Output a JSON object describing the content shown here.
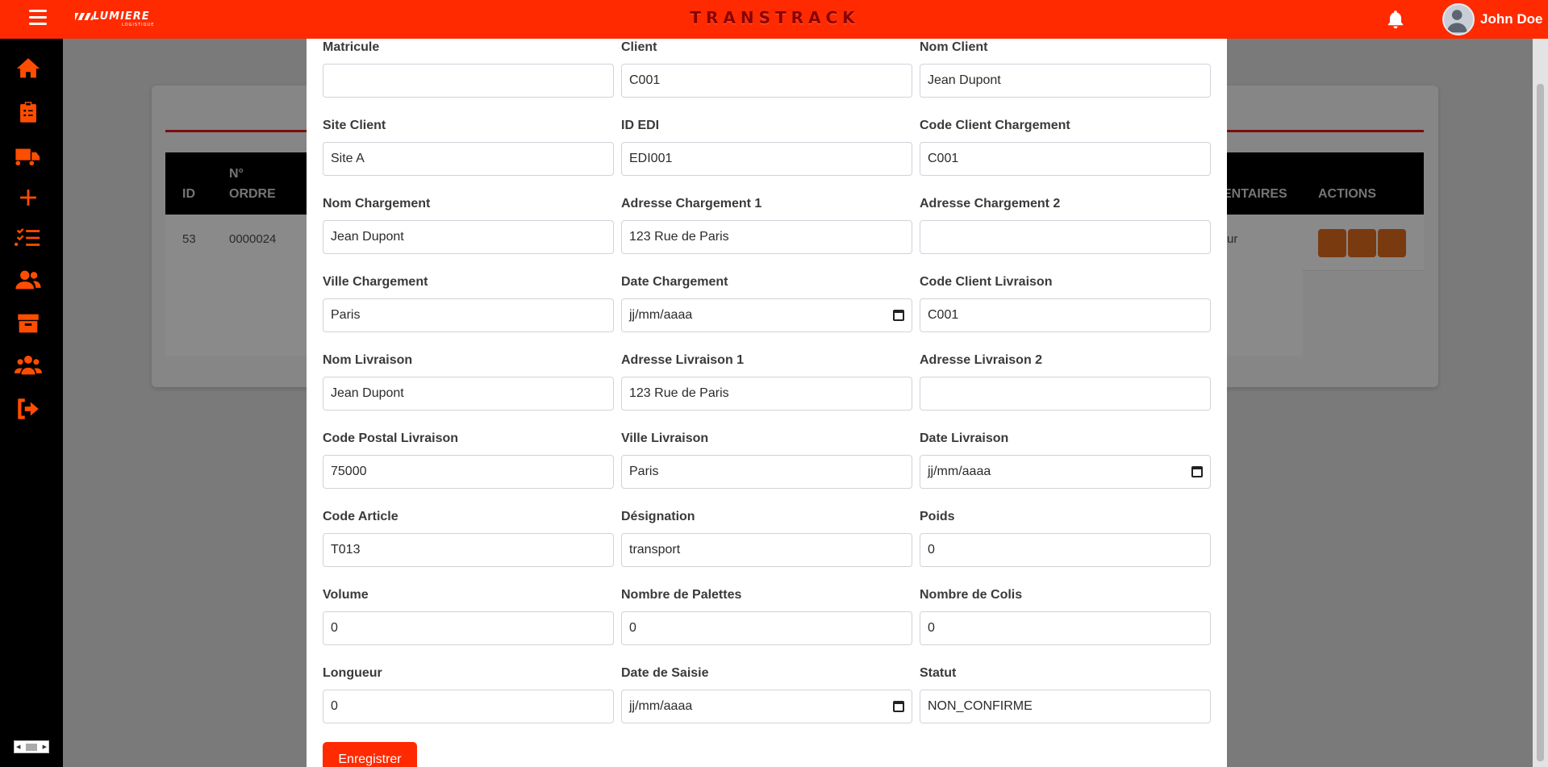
{
  "header": {
    "brand": "TRANSTRACK",
    "logo_text": "LUMIERE",
    "logo_sub": "LOGISTIQUE",
    "username": "John Doe",
    "accent_color": "#ff2a00"
  },
  "sidebar": {
    "icons": [
      "home-icon",
      "clipboard-icon",
      "truck-icon",
      "plus-icon",
      "list-check-icon",
      "users-icon",
      "box-icon",
      "users-group-icon",
      "sign-out-icon"
    ]
  },
  "background_table": {
    "headers": [
      "ID",
      "N°",
      "ORDRE",
      "ENTAIRES",
      "ACTIONS"
    ],
    "row": {
      "id": "53",
      "ordre": "0000024",
      "partial": "ur"
    }
  },
  "form": {
    "fields": [
      {
        "label": "Matricule",
        "value": "",
        "type": "text"
      },
      {
        "label": "Client",
        "value": "C001",
        "type": "text"
      },
      {
        "label": "Nom Client",
        "value": "Jean Dupont",
        "type": "text"
      },
      {
        "label": "Site Client",
        "value": "Site A",
        "type": "text"
      },
      {
        "label": "ID EDI",
        "value": "EDI001",
        "type": "text"
      },
      {
        "label": "Code Client Chargement",
        "value": "C001",
        "type": "text"
      },
      {
        "label": "Nom Chargement",
        "value": "Jean Dupont",
        "type": "text"
      },
      {
        "label": "Adresse Chargement 1",
        "value": "123 Rue de Paris",
        "type": "text"
      },
      {
        "label": "Adresse Chargement 2",
        "value": "",
        "type": "text"
      },
      {
        "label": "Ville Chargement",
        "value": "Paris",
        "type": "text"
      },
      {
        "label": "Date Chargement",
        "value": "jj/mm/aaaa",
        "type": "date"
      },
      {
        "label": "Code Client Livraison",
        "value": "C001",
        "type": "text"
      },
      {
        "label": "Nom Livraison",
        "value": "Jean Dupont",
        "type": "text"
      },
      {
        "label": "Adresse Livraison 1",
        "value": "123 Rue de Paris",
        "type": "text"
      },
      {
        "label": "Adresse Livraison 2",
        "value": "",
        "type": "text"
      },
      {
        "label": "Code Postal Livraison",
        "value": "75000",
        "type": "text"
      },
      {
        "label": "Ville Livraison",
        "value": "Paris",
        "type": "text"
      },
      {
        "label": "Date Livraison",
        "value": "jj/mm/aaaa",
        "type": "date"
      },
      {
        "label": "Code Article",
        "value": "T013",
        "type": "text"
      },
      {
        "label": "Désignation",
        "value": "transport",
        "type": "text"
      },
      {
        "label": "Poids",
        "value": "0",
        "type": "text"
      },
      {
        "label": "Volume",
        "value": "0",
        "type": "text"
      },
      {
        "label": "Nombre de Palettes",
        "value": "0",
        "type": "text"
      },
      {
        "label": "Nombre de Colis",
        "value": "0",
        "type": "text"
      },
      {
        "label": "Longueur",
        "value": "0",
        "type": "text"
      },
      {
        "label": "Date de Saisie",
        "value": "jj/mm/aaaa",
        "type": "date"
      },
      {
        "label": "Statut",
        "value": "NON_CONFIRME",
        "type": "text"
      }
    ],
    "save_label": "Enregistrer"
  }
}
